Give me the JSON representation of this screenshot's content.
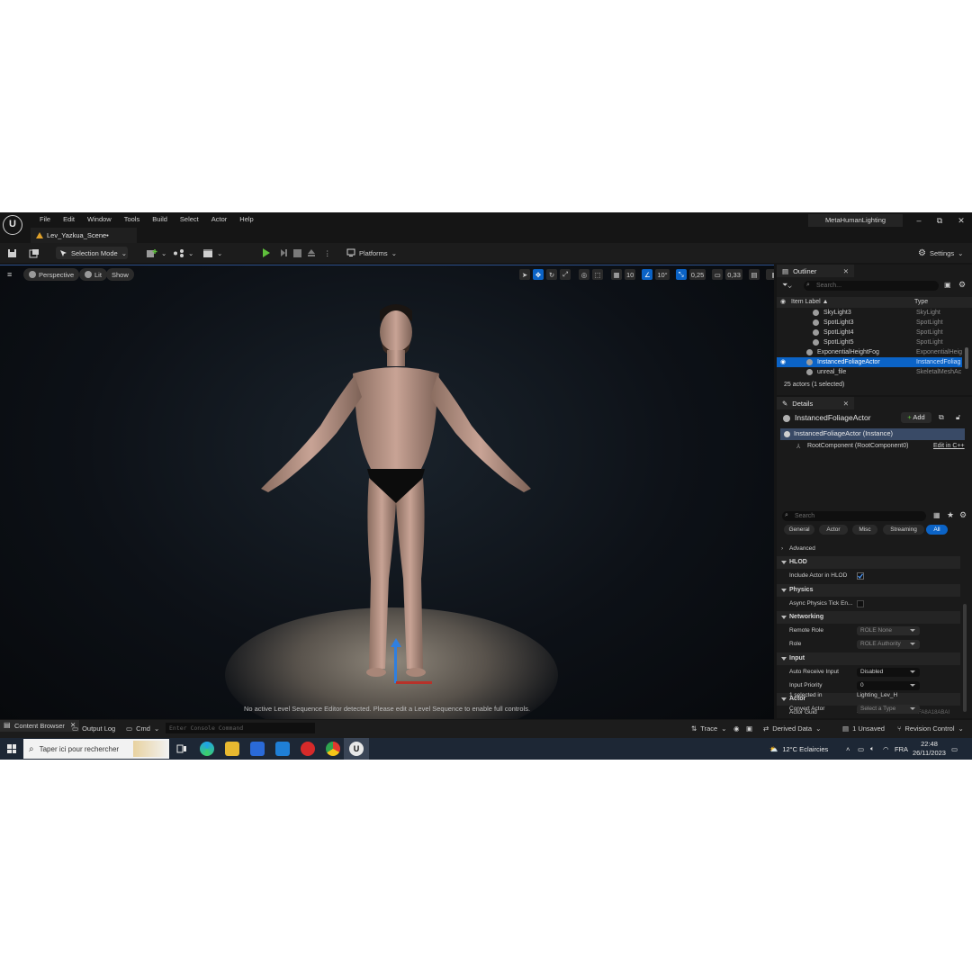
{
  "titlebar": {
    "logo": "U",
    "menu": [
      "File",
      "Edit",
      "Window",
      "Tools",
      "Build",
      "Select",
      "Actor",
      "Help"
    ],
    "tab_label": "Lev_Yazkua_Scene•",
    "project_name": "MetaHumanLighting",
    "min": "–",
    "max": "⧉",
    "close": "✕"
  },
  "toolbar": {
    "selection_mode": "Selection Mode",
    "platforms": "Platforms",
    "settings": "Settings"
  },
  "viewport": {
    "perspective": "Perspective",
    "lit": "Lit",
    "show": "Show",
    "grid_snap": "10",
    "rot_snap": "10°",
    "scale_snap": "0,25",
    "cam_speed": "0,33",
    "seq_message": "No active Level Sequence Editor detected. Please edit a Level Sequence to enable full controls."
  },
  "outliner": {
    "title": "Outliner",
    "search_placeholder": "Search...",
    "col_label": "Item Label ▲",
    "col_type": "Type",
    "rows": [
      {
        "label": "SkyLight3",
        "type": "SkyLight"
      },
      {
        "label": "SpotLight3",
        "type": "SpotLight"
      },
      {
        "label": "SpotLight4",
        "type": "SpotLight"
      },
      {
        "label": "SpotLight5",
        "type": "SpotLight"
      },
      {
        "label": "ExponentialHeightFog",
        "type": "ExponentialHeig"
      },
      {
        "label": "InstancedFoliageActor",
        "type": "InstancedFoliag"
      },
      {
        "label": "unreal_file",
        "type": "SkeletalMeshAc"
      }
    ],
    "footer": "25 actors (1 selected)"
  },
  "details": {
    "title": "Details",
    "actor_name": "InstancedFoliageActor",
    "add_label": "Add",
    "instance_label": "InstancedFoliageActor (Instance)",
    "root_component": "RootComponent (RootComponent0)",
    "edit_cpp": "Edit in C++",
    "search_placeholder": "Search",
    "filters": [
      "General",
      "Actor",
      "Misc",
      "Streaming",
      "All"
    ],
    "advanced": "Advanced",
    "sections": {
      "hlod": "HLOD",
      "physics": "Physics",
      "networking": "Networking",
      "input": "Input",
      "actor": "Actor"
    },
    "props": {
      "include_hlod": "Include Actor in HLOD",
      "async_physics": "Async Physics Tick En...",
      "remote_role": "Remote Role",
      "remote_role_val": "ROLE None",
      "role": "Role",
      "role_val": "ROLE Authority",
      "auto_receive": "Auto Receive Input",
      "auto_receive_val": "Disabled",
      "input_priority": "Input Priority",
      "input_priority_val": "0",
      "actor_guid": "Actor Guid",
      "actor_guid_val": "4AC7E4B743F79365BA9FA8A18ABAI",
      "selected_in": "1 selected in",
      "selected_in_val": "Lighting_Lev_H",
      "convert_actor": "Convert Actor",
      "convert_actor_val": "Select a Type"
    }
  },
  "bottombar": {
    "content_browser": "Content Browser",
    "output_log": "Output Log",
    "cmd": "Cmd",
    "console_placeholder": "Enter Console Command",
    "trace": "Trace",
    "derived_data": "Derived Data",
    "unsaved": "1 Unsaved",
    "revision_control": "Revision Control"
  },
  "taskbar": {
    "search_text": "Taper ici pour rechercher",
    "weather": "12°C  Eclaircies",
    "lang": "FRA",
    "time": "22:48",
    "date": "26/11/2023"
  }
}
